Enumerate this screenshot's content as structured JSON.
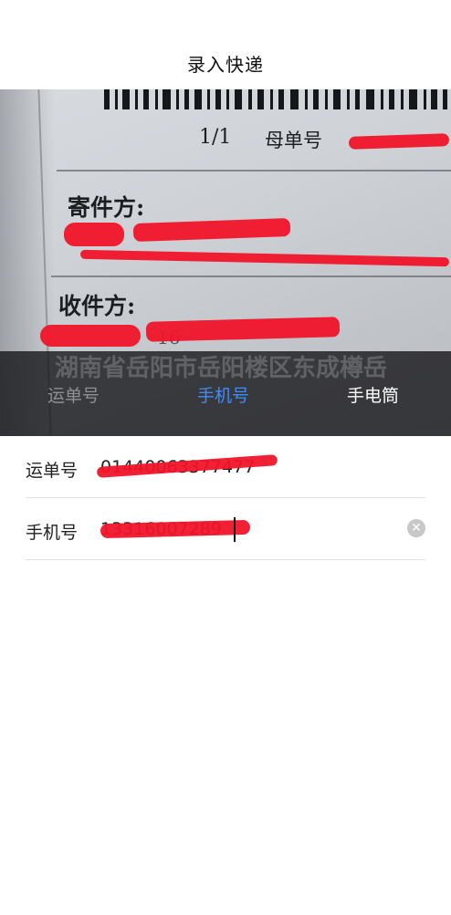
{
  "header": {
    "title": "录入快递"
  },
  "camera_preview": {
    "page_count": "1/1",
    "master_label": "母单号",
    "sender_label": "寄件方:",
    "receiver_label": "收件方:",
    "address_fragment": "湖南省岳阳市岳阳楼区东成樽岳",
    "number_fragment": "16"
  },
  "mode_tabs": [
    {
      "label": "运单号",
      "state": "inactive"
    },
    {
      "label": "手机号",
      "state": "active"
    },
    {
      "label": "手电筒",
      "state": "normal"
    }
  ],
  "form": {
    "waybill": {
      "label": "运单号",
      "value": "01440063377477"
    },
    "phone": {
      "label": "手机号",
      "value": "13316007289"
    }
  },
  "colors": {
    "accent": "#3f8cff",
    "redaction": "#f0142a",
    "mode_bar": "#121214"
  }
}
